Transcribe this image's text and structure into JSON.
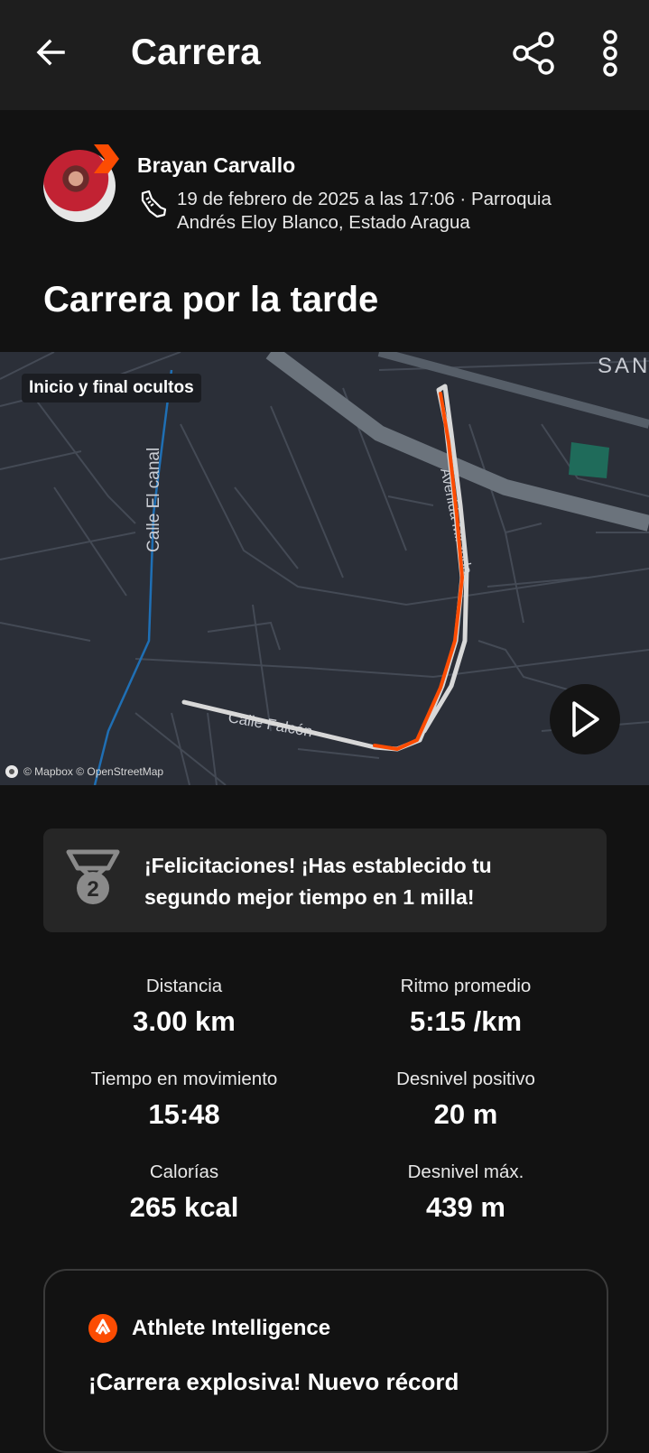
{
  "header": {
    "title": "Carrera"
  },
  "athlete": {
    "name": "Brayan Carvallo",
    "meta": "19 de febrero de 2025 a las 17:06 · Parroquia Andrés Eloy Blanco, Estado Aragua"
  },
  "activity": {
    "title": "Carrera por la tarde"
  },
  "map": {
    "privacy_label": "Inicio y final ocultos",
    "street_canal": "Calle El canal",
    "street_falcon": "Calle Falcón",
    "street_avenida": "Avenida Miranda",
    "area_label": "SAN",
    "attribution": "© Mapbox © OpenStreetMap",
    "route_color": "#fc4c02"
  },
  "achievement": {
    "text": "¡Felicitaciones! ¡Has establecido tu segundo mejor tiempo en 1 milla!",
    "rank": "2"
  },
  "stats": [
    {
      "label": "Distancia",
      "value": "3.00 km"
    },
    {
      "label": "Ritmo promedio",
      "value": "5:15 /km"
    },
    {
      "label": "Tiempo en movimiento",
      "value": "15:48"
    },
    {
      "label": "Desnivel positivo",
      "value": "20 m"
    },
    {
      "label": "Calorías",
      "value": "265 kcal"
    },
    {
      "label": "Desnivel máx.",
      "value": "439 m"
    }
  ],
  "athlete_intelligence": {
    "title": "Athlete Intelligence",
    "snippet": "¡Carrera explosiva! Nuevo récord"
  },
  "colors": {
    "accent": "#fc4c02",
    "background": "#121212",
    "topbar": "#1e1e1e",
    "card": "#262626"
  }
}
